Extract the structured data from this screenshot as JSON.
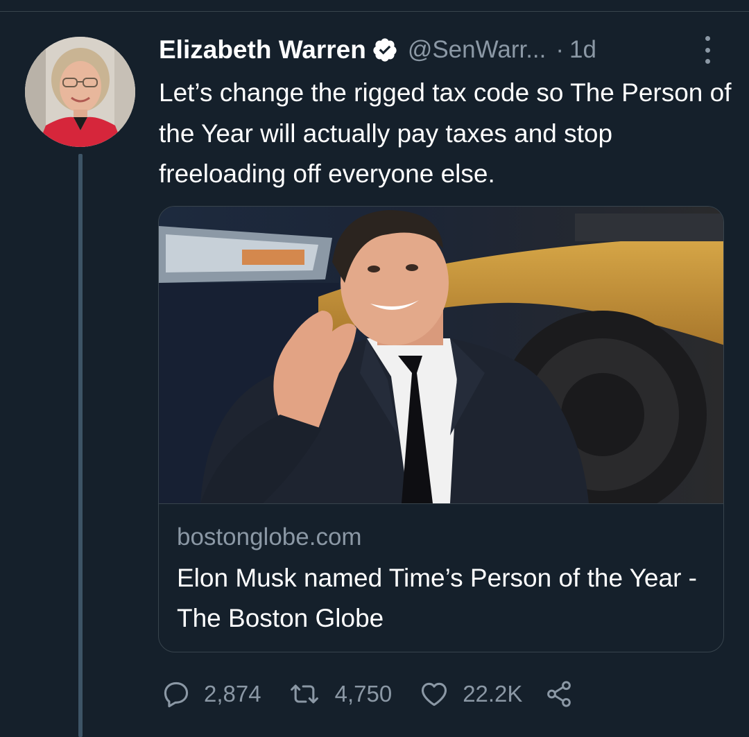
{
  "tweet": {
    "author_name": "Elizabeth Warren",
    "handle": "@SenWarr...",
    "separator": "·",
    "time": "1d",
    "text": "Let’s change the rigged tax code so The Person of the Year will actually pay taxes and stop freeloading off everyone else."
  },
  "card": {
    "domain": "bostonglobe.com",
    "title": "Elon Musk named Time’s Person of the Year - The Boston Globe"
  },
  "actions": {
    "replies": "2,874",
    "retweets": "4,750",
    "likes": "22.2K"
  },
  "icons": {
    "verified": "verified-badge-icon",
    "more": "more-vertical-icon",
    "reply": "reply-icon",
    "retweet": "retweet-icon",
    "like": "heart-icon",
    "share": "share-icon"
  },
  "colors": {
    "background": "#15202b",
    "text_primary": "#ffffff",
    "text_secondary": "#8b98a5",
    "border": "#38444d",
    "thread_line": "#3d5466"
  }
}
